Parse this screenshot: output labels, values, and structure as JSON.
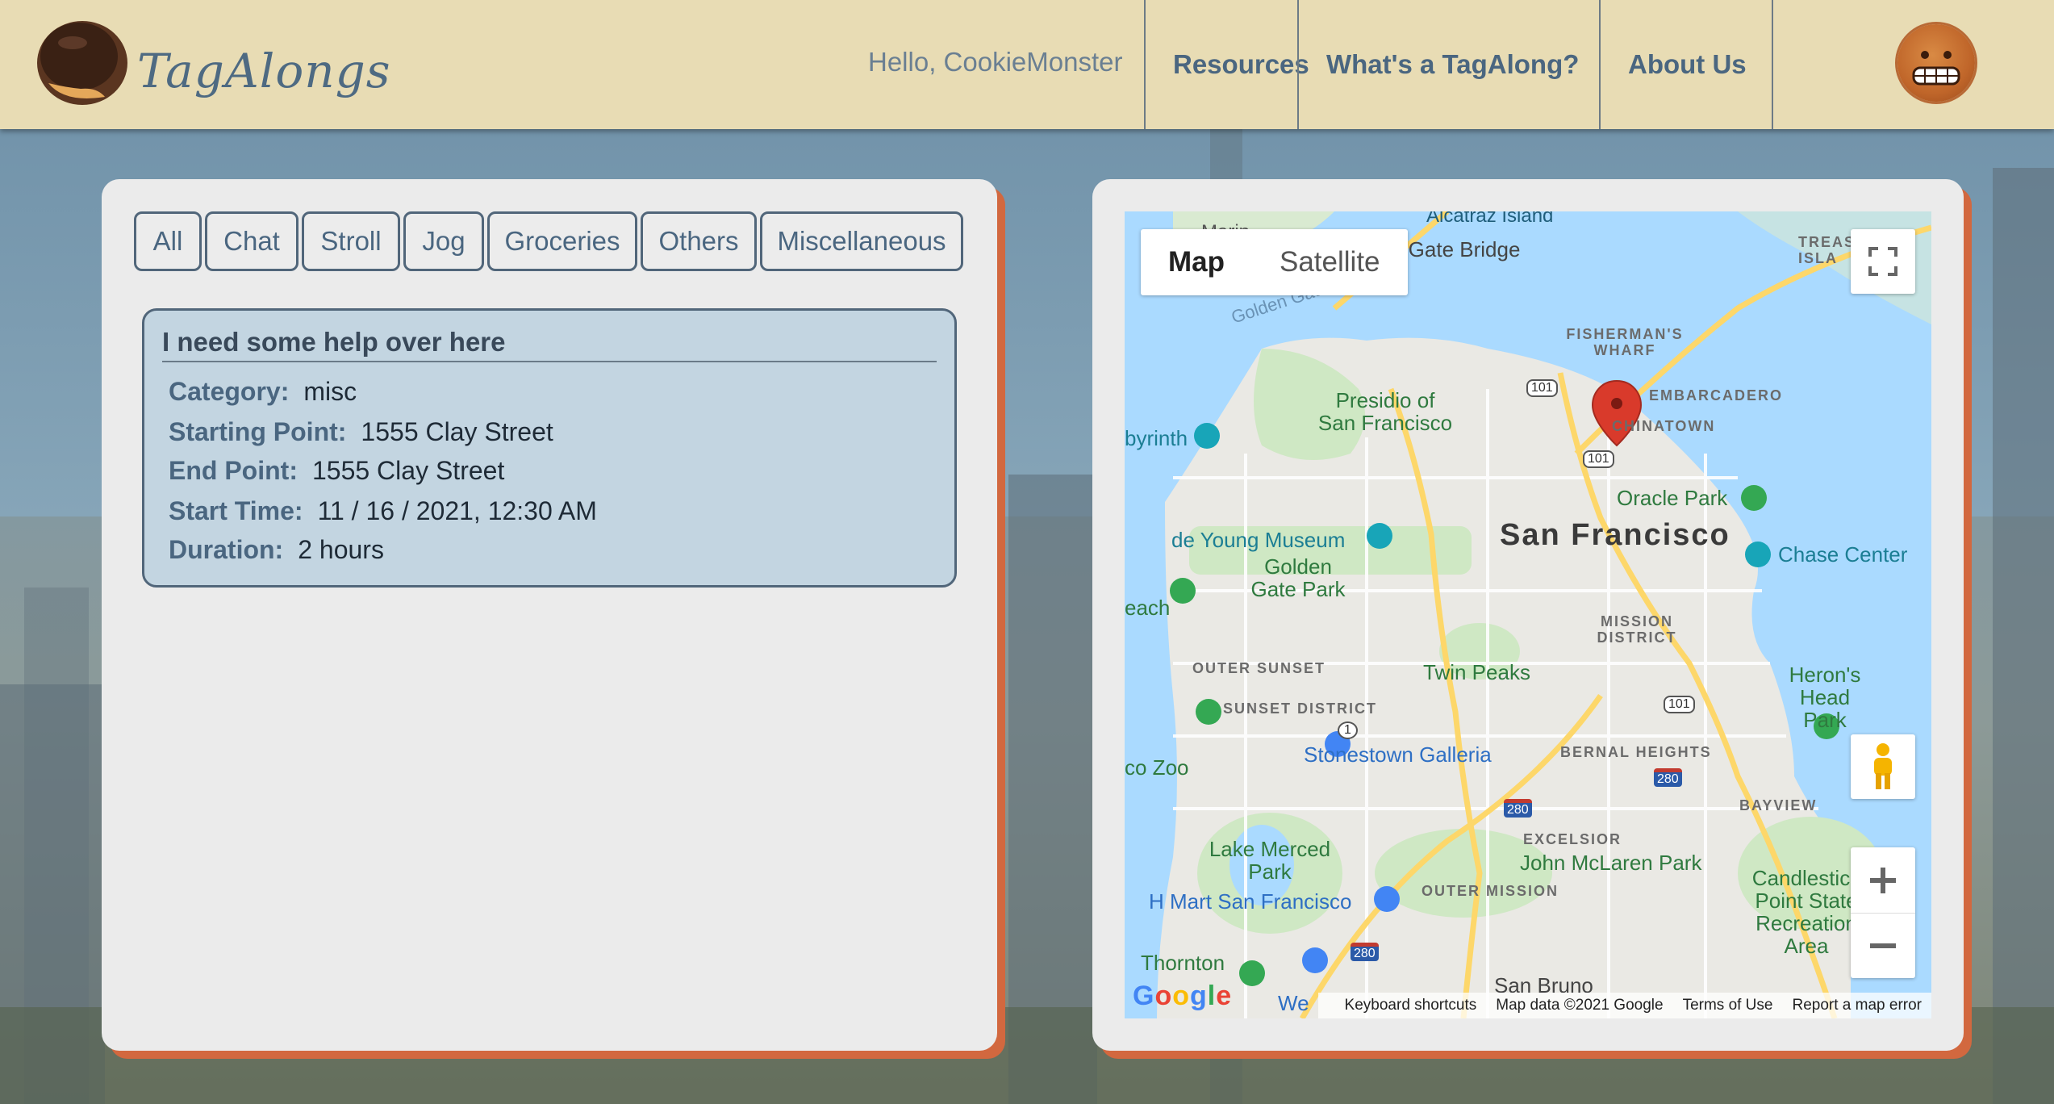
{
  "header": {
    "logo_text": "TagAlongs",
    "greeting": "Hello, CookieMonster",
    "nav": [
      "Resources",
      "What's a TagAlong?",
      "About Us"
    ]
  },
  "filters": [
    "All",
    "Chat",
    "Stroll",
    "Jog",
    "Groceries",
    "Others",
    "Miscellaneous"
  ],
  "card": {
    "title": "I need some help over here",
    "category_label": "Category:",
    "category": "misc",
    "start_label": "Starting Point:",
    "start": "1555 Clay Street",
    "end_label": "End Point:",
    "end": "1555 Clay Street",
    "time_label": "Start Time:",
    "time": "11 / 16 / 2021, 12:30 AM",
    "duration_label": "Duration:",
    "duration": "2 hours"
  },
  "map": {
    "type_map": "Map",
    "type_satellite": "Satellite",
    "footer": {
      "shortcuts": "Keyboard shortcuts",
      "data": "Map data ©2021 Google",
      "terms": "Terms of Use",
      "report": "Report a map error"
    },
    "labels": {
      "sf": "San Francisco",
      "presidio": "Presidio of San Francisco",
      "oracle": "Oracle Park",
      "chase": "Chase Center",
      "deyoung": "de Young Museum",
      "ggpark": "Golden Gate Park",
      "twinpeaks": "Twin Peaks",
      "stonestown": "Stonestown Galleria",
      "lake": "Lake Merced Park",
      "hmart": "H Mart San Francisco",
      "mclaren": "John McLaren Park",
      "candlestick": "Candlestick Point State Recreation Area",
      "herons": "Heron's Head Park",
      "sanbruno": "San Bruno",
      "thornton": "Thornton",
      "gg_bridge": "n Gate Bridge",
      "golden_gate": "Golden Gate",
      "labyrinth": "byrinth",
      "beach": "each",
      "zoo": "co Zoo",
      "alcatraz": "Alcatraz Island",
      "marin": "Marin",
      "treas": "TREAS ISLA",
      "wharf": "FISHERMAN'S WHARF",
      "embarcadero": "EMBARCADERO",
      "chinatown": "CHINATOWN",
      "mission": "MISSION DISTRICT",
      "outer_sunset": "OUTER SUNSET",
      "sunset": "SUNSET DISTRICT",
      "bernal": "BERNAL HEIGHTS",
      "bayview": "BAYVIEW",
      "excelsior": "EXCELSIOR",
      "outer_mission": "OUTER MISSION",
      "we": "We",
      "hwy101": "101",
      "hwy1": "1",
      "hwy280": "280"
    }
  },
  "colors": {
    "header_bg": "#e8dcb4",
    "panel_accent": "#d2683f",
    "nav_text": "#4a6680",
    "card_bg": "#c3d5e1"
  }
}
